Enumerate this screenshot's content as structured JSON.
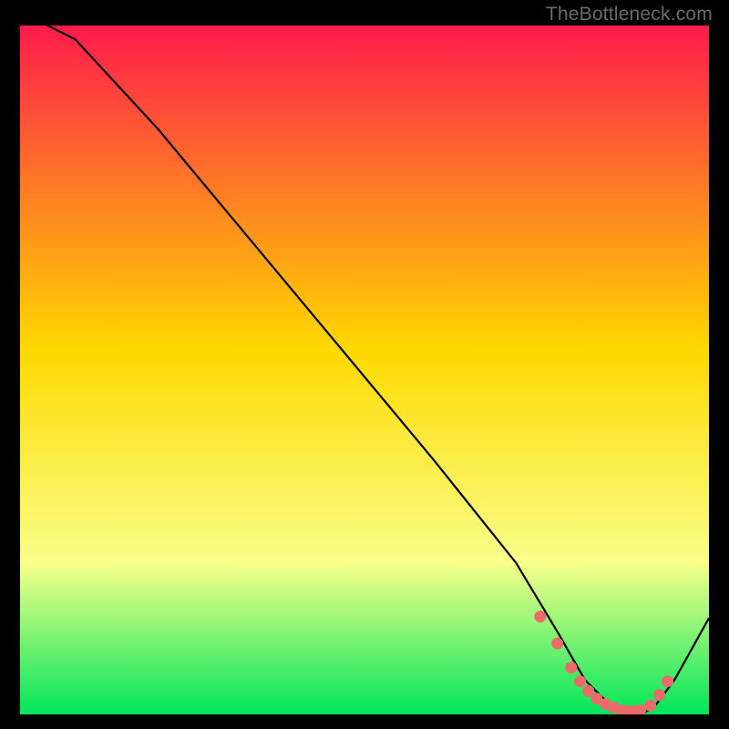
{
  "watermark": {
    "text": "TheBottleneck.com"
  },
  "colors": {
    "gradient_top": "#ff1b4b",
    "gradient_mid": "#ffd900",
    "gradient_low": "#f8ff8a",
    "gradient_bottom": "#00e65a",
    "curve": "#000000",
    "marker": "#ec6a6a",
    "background": "#000000"
  },
  "chart_data": {
    "type": "line",
    "title": "",
    "xlabel": "",
    "ylabel": "",
    "xlim": [
      0,
      100
    ],
    "ylim": [
      0,
      100
    ],
    "grid": false,
    "legend": false,
    "series": [
      {
        "name": "curve",
        "x": [
          0,
          2,
          8,
          20,
          40,
          60,
          72,
          78,
          82,
          86,
          90,
          92,
          95,
          100
        ],
        "y": [
          102,
          101,
          98,
          85,
          61,
          37,
          22,
          12,
          5,
          1,
          0,
          1,
          5,
          14
        ]
      }
    ],
    "markers": {
      "name": "highlight-band",
      "x": [
        75.5,
        78.0,
        80.0,
        81.3,
        82.5,
        83.7,
        85.0,
        86.2,
        87.5,
        88.7,
        90.0,
        91.5,
        92.8,
        94.0
      ],
      "y": [
        14.2,
        10.3,
        6.8,
        4.8,
        3.4,
        2.3,
        1.5,
        1.0,
        0.6,
        0.5,
        0.6,
        1.3,
        2.8,
        4.8
      ]
    }
  }
}
